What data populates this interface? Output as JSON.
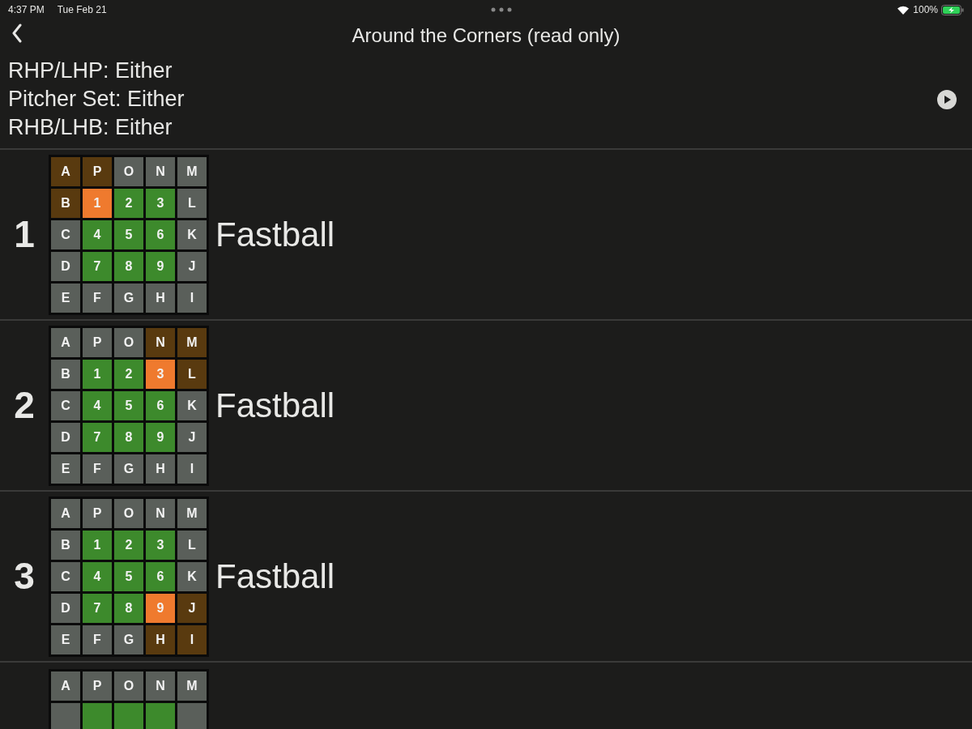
{
  "status_bar": {
    "time": "4:37 PM",
    "date": "Tue Feb 21",
    "battery": "100%"
  },
  "nav": {
    "title": "Around the Corners (read only)"
  },
  "filters": [
    "RHP/LHP: Either",
    "Pitcher Set: Either",
    "RHB/LHB: Either"
  ],
  "pitches": [
    {
      "number": "1",
      "name": "Fastball",
      "grid": [
        [
          {
            "label": "A",
            "kind": "adjacent"
          },
          {
            "label": "P",
            "kind": "adjacent"
          },
          {
            "label": "O",
            "kind": "outer"
          },
          {
            "label": "N",
            "kind": "outer"
          },
          {
            "label": "M",
            "kind": "outer"
          }
        ],
        [
          {
            "label": "B",
            "kind": "adjacent"
          },
          {
            "label": "1",
            "kind": "target"
          },
          {
            "label": "2",
            "kind": "strike"
          },
          {
            "label": "3",
            "kind": "strike"
          },
          {
            "label": "L",
            "kind": "outer"
          }
        ],
        [
          {
            "label": "C",
            "kind": "outer"
          },
          {
            "label": "4",
            "kind": "strike"
          },
          {
            "label": "5",
            "kind": "strike"
          },
          {
            "label": "6",
            "kind": "strike"
          },
          {
            "label": "K",
            "kind": "outer"
          }
        ],
        [
          {
            "label": "D",
            "kind": "outer"
          },
          {
            "label": "7",
            "kind": "strike"
          },
          {
            "label": "8",
            "kind": "strike"
          },
          {
            "label": "9",
            "kind": "strike"
          },
          {
            "label": "J",
            "kind": "outer"
          }
        ],
        [
          {
            "label": "E",
            "kind": "outer"
          },
          {
            "label": "F",
            "kind": "outer"
          },
          {
            "label": "G",
            "kind": "outer"
          },
          {
            "label": "H",
            "kind": "outer"
          },
          {
            "label": "I",
            "kind": "outer"
          }
        ]
      ]
    },
    {
      "number": "2",
      "name": "Fastball",
      "grid": [
        [
          {
            "label": "A",
            "kind": "outer"
          },
          {
            "label": "P",
            "kind": "outer"
          },
          {
            "label": "O",
            "kind": "outer"
          },
          {
            "label": "N",
            "kind": "adjacent"
          },
          {
            "label": "M",
            "kind": "adjacent"
          }
        ],
        [
          {
            "label": "B",
            "kind": "outer"
          },
          {
            "label": "1",
            "kind": "strike"
          },
          {
            "label": "2",
            "kind": "strike"
          },
          {
            "label": "3",
            "kind": "target"
          },
          {
            "label": "L",
            "kind": "adjacent"
          }
        ],
        [
          {
            "label": "C",
            "kind": "outer"
          },
          {
            "label": "4",
            "kind": "strike"
          },
          {
            "label": "5",
            "kind": "strike"
          },
          {
            "label": "6",
            "kind": "strike"
          },
          {
            "label": "K",
            "kind": "outer"
          }
        ],
        [
          {
            "label": "D",
            "kind": "outer"
          },
          {
            "label": "7",
            "kind": "strike"
          },
          {
            "label": "8",
            "kind": "strike"
          },
          {
            "label": "9",
            "kind": "strike"
          },
          {
            "label": "J",
            "kind": "outer"
          }
        ],
        [
          {
            "label": "E",
            "kind": "outer"
          },
          {
            "label": "F",
            "kind": "outer"
          },
          {
            "label": "G",
            "kind": "outer"
          },
          {
            "label": "H",
            "kind": "outer"
          },
          {
            "label": "I",
            "kind": "outer"
          }
        ]
      ]
    },
    {
      "number": "3",
      "name": "Fastball",
      "grid": [
        [
          {
            "label": "A",
            "kind": "outer"
          },
          {
            "label": "P",
            "kind": "outer"
          },
          {
            "label": "O",
            "kind": "outer"
          },
          {
            "label": "N",
            "kind": "outer"
          },
          {
            "label": "M",
            "kind": "outer"
          }
        ],
        [
          {
            "label": "B",
            "kind": "outer"
          },
          {
            "label": "1",
            "kind": "strike"
          },
          {
            "label": "2",
            "kind": "strike"
          },
          {
            "label": "3",
            "kind": "strike"
          },
          {
            "label": "L",
            "kind": "outer"
          }
        ],
        [
          {
            "label": "C",
            "kind": "outer"
          },
          {
            "label": "4",
            "kind": "strike"
          },
          {
            "label": "5",
            "kind": "strike"
          },
          {
            "label": "6",
            "kind": "strike"
          },
          {
            "label": "K",
            "kind": "outer"
          }
        ],
        [
          {
            "label": "D",
            "kind": "outer"
          },
          {
            "label": "7",
            "kind": "strike"
          },
          {
            "label": "8",
            "kind": "strike"
          },
          {
            "label": "9",
            "kind": "target"
          },
          {
            "label": "J",
            "kind": "adjacent"
          }
        ],
        [
          {
            "label": "E",
            "kind": "outer"
          },
          {
            "label": "F",
            "kind": "outer"
          },
          {
            "label": "G",
            "kind": "outer"
          },
          {
            "label": "H",
            "kind": "adjacent"
          },
          {
            "label": "I",
            "kind": "adjacent"
          }
        ]
      ]
    },
    {
      "grid": [
        [
          {
            "label": "A",
            "kind": "outer"
          },
          {
            "label": "P",
            "kind": "outer"
          },
          {
            "label": "O",
            "kind": "outer"
          },
          {
            "label": "N",
            "kind": "outer"
          },
          {
            "label": "M",
            "kind": "outer"
          }
        ],
        [
          {
            "kind": "outer"
          },
          {
            "kind": "strike"
          },
          {
            "kind": "strike"
          },
          {
            "kind": "strike"
          },
          {
            "kind": "outer"
          }
        ]
      ]
    }
  ]
}
